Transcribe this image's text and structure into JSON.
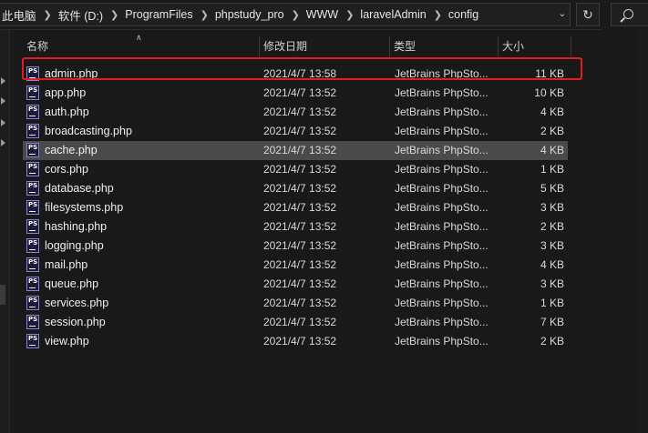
{
  "breadcrumb": [
    "此电脑",
    "软件 (D:)",
    "ProgramFiles",
    "phpstudy_pro",
    "WWW",
    "laravelAdmin",
    "config"
  ],
  "columns": {
    "name": "名称",
    "date": "修改日期",
    "type": "类型",
    "size": "大小"
  },
  "icons": {
    "file": "phpstorm-file-icon",
    "file_icon_text": "PS",
    "search": "search-icon",
    "refresh": "refresh-icon",
    "dropdown": "chevron-down-icon",
    "sort": "sort-ascending-icon"
  },
  "colors": {
    "highlight": "#e01e1e",
    "selected_row": "#4a4a4a",
    "background": "#191919"
  },
  "files": [
    {
      "name": "admin.php",
      "date": "2021/4/7 13:58",
      "type": "JetBrains PhpSto...",
      "size": "11 KB"
    },
    {
      "name": "app.php",
      "date": "2021/4/7 13:52",
      "type": "JetBrains PhpSto...",
      "size": "10 KB"
    },
    {
      "name": "auth.php",
      "date": "2021/4/7 13:52",
      "type": "JetBrains PhpSto...",
      "size": "4 KB"
    },
    {
      "name": "broadcasting.php",
      "date": "2021/4/7 13:52",
      "type": "JetBrains PhpSto...",
      "size": "2 KB"
    },
    {
      "name": "cache.php",
      "date": "2021/4/7 13:52",
      "type": "JetBrains PhpSto...",
      "size": "4 KB"
    },
    {
      "name": "cors.php",
      "date": "2021/4/7 13:52",
      "type": "JetBrains PhpSto...",
      "size": "1 KB"
    },
    {
      "name": "database.php",
      "date": "2021/4/7 13:52",
      "type": "JetBrains PhpSto...",
      "size": "5 KB"
    },
    {
      "name": "filesystems.php",
      "date": "2021/4/7 13:52",
      "type": "JetBrains PhpSto...",
      "size": "3 KB"
    },
    {
      "name": "hashing.php",
      "date": "2021/4/7 13:52",
      "type": "JetBrains PhpSto...",
      "size": "2 KB"
    },
    {
      "name": "logging.php",
      "date": "2021/4/7 13:52",
      "type": "JetBrains PhpSto...",
      "size": "3 KB"
    },
    {
      "name": "mail.php",
      "date": "2021/4/7 13:52",
      "type": "JetBrains PhpSto...",
      "size": "4 KB"
    },
    {
      "name": "queue.php",
      "date": "2021/4/7 13:52",
      "type": "JetBrains PhpSto...",
      "size": "3 KB"
    },
    {
      "name": "services.php",
      "date": "2021/4/7 13:52",
      "type": "JetBrains PhpSto...",
      "size": "1 KB"
    },
    {
      "name": "session.php",
      "date": "2021/4/7 13:52",
      "type": "JetBrains PhpSto...",
      "size": "7 KB"
    },
    {
      "name": "view.php",
      "date": "2021/4/7 13:52",
      "type": "JetBrains PhpSto...",
      "size": "2 KB"
    }
  ],
  "selected_file": "cache.php",
  "highlighted_file": "admin.php"
}
